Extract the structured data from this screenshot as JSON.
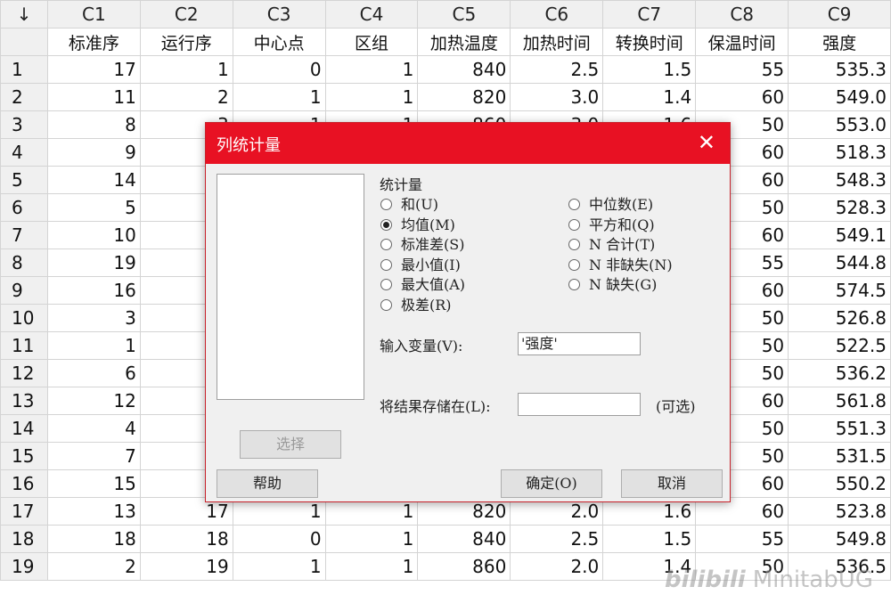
{
  "sheet": {
    "corner_icon": "arrow-down",
    "columns": [
      "C1",
      "C2",
      "C3",
      "C4",
      "C5",
      "C6",
      "C7",
      "C8",
      "C9"
    ],
    "names": [
      "标准序",
      "运行序",
      "中心点",
      "区组",
      "加热温度",
      "加热时间",
      "转换时间",
      "保温时间",
      "强度"
    ],
    "rows": [
      [
        "1",
        "17",
        "1",
        "0",
        "1",
        "840",
        "2.5",
        "1.5",
        "55",
        "535.3"
      ],
      [
        "2",
        "11",
        "2",
        "1",
        "1",
        "820",
        "3.0",
        "1.4",
        "60",
        "549.0"
      ],
      [
        "3",
        "8",
        "3",
        "1",
        "1",
        "860",
        "3.0",
        "1.6",
        "50",
        "553.0"
      ],
      [
        "4",
        "9",
        "",
        "",
        "",
        "",
        "",
        "",
        "60",
        "518.3"
      ],
      [
        "5",
        "14",
        "",
        "",
        "",
        "",
        "",
        "",
        "60",
        "548.3"
      ],
      [
        "6",
        "5",
        "",
        "",
        "",
        "",
        "",
        "",
        "50",
        "528.3"
      ],
      [
        "7",
        "10",
        "",
        "",
        "",
        "",
        "",
        "",
        "60",
        "549.1"
      ],
      [
        "8",
        "19",
        "",
        "",
        "",
        "",
        "",
        "",
        "55",
        "544.8"
      ],
      [
        "9",
        "16",
        "",
        "",
        "",
        "",
        "",
        "",
        "60",
        "574.5"
      ],
      [
        "10",
        "3",
        "",
        "",
        "",
        "",
        "",
        "",
        "50",
        "526.8"
      ],
      [
        "11",
        "1",
        "",
        "",
        "",
        "",
        "",
        "",
        "50",
        "522.5"
      ],
      [
        "12",
        "6",
        "",
        "",
        "",
        "",
        "",
        "",
        "50",
        "536.2"
      ],
      [
        "13",
        "12",
        "",
        "",
        "",
        "",
        "",
        "",
        "60",
        "561.8"
      ],
      [
        "14",
        "4",
        "",
        "",
        "",
        "",
        "",
        "",
        "50",
        "551.3"
      ],
      [
        "15",
        "7",
        "",
        "",
        "",
        "",
        "",
        "",
        "50",
        "531.5"
      ],
      [
        "16",
        "15",
        "",
        "",
        "",
        "",
        "",
        "",
        "60",
        "550.2"
      ],
      [
        "17",
        "13",
        "17",
        "1",
        "1",
        "820",
        "2.0",
        "1.6",
        "60",
        "523.8"
      ],
      [
        "18",
        "18",
        "18",
        "0",
        "1",
        "840",
        "2.5",
        "1.5",
        "55",
        "549.8"
      ],
      [
        "19",
        "2",
        "19",
        "1",
        "1",
        "860",
        "2.0",
        "1.4",
        "50",
        "536.5"
      ]
    ]
  },
  "dialog": {
    "title": "列统计量",
    "stats_group_label": "统计量",
    "radios_left": [
      "和(U)",
      "均值(M)",
      "标准差(S)",
      "最小值(I)",
      "最大值(A)",
      "极差(R)"
    ],
    "radios_right": [
      "中位数(E)",
      "平方和(Q)",
      "N 合计(T)",
      "N 非缺失(N)",
      "N 缺失(G)"
    ],
    "selected": "均值(M)",
    "input_label": "输入变量(V):",
    "input_value": "'强度'",
    "store_label": "将结果存储在(L):",
    "store_value": "",
    "optional_label": "(可选)",
    "select_button": "选择",
    "help_button": "帮助",
    "ok_button": "确定(O)",
    "cancel_button": "取消",
    "close_icon": "close-icon"
  },
  "watermark": {
    "logo": "bilibili",
    "text": "MinitabUG"
  }
}
